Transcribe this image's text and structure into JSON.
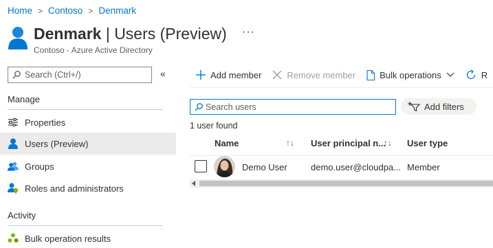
{
  "breadcrumb": {
    "items": [
      "Home",
      "Contoso",
      "Denmark"
    ],
    "separator": ">"
  },
  "header": {
    "title_bold": "Denmark",
    "title_rest": " | Users (Preview)",
    "more": "···",
    "subtitle": "Contoso - Azure Active Directory"
  },
  "sidebar": {
    "search_placeholder": "Search (Ctrl+/)",
    "collapse": "«",
    "sections": [
      {
        "title": "Manage",
        "items": [
          {
            "label": "Properties",
            "icon": "properties-icon"
          },
          {
            "label": "Users (Preview)",
            "icon": "user-icon",
            "active": true
          },
          {
            "label": "Groups",
            "icon": "groups-icon"
          },
          {
            "label": "Roles and administrators",
            "icon": "roles-icon"
          }
        ]
      },
      {
        "title": "Activity",
        "items": [
          {
            "label": "Bulk operation results",
            "icon": "bulk-results-icon"
          }
        ]
      }
    ]
  },
  "toolbar": {
    "add_member": "Add member",
    "remove_member": "Remove member",
    "bulk_operations": "Bulk operations",
    "refresh": "R"
  },
  "search": {
    "placeholder": "Search users"
  },
  "filters": {
    "add_label": "Add filters"
  },
  "results": {
    "count_text": "1 user found"
  },
  "table": {
    "columns": [
      "Name",
      "User principal n...",
      "User type"
    ],
    "rows": [
      {
        "name": "Demo User",
        "upn": "demo.user@cloudpa...",
        "type": "Member"
      }
    ]
  },
  "colors": {
    "accent": "#0078d4",
    "active_bg": "#edebe9",
    "text": "#323130"
  }
}
